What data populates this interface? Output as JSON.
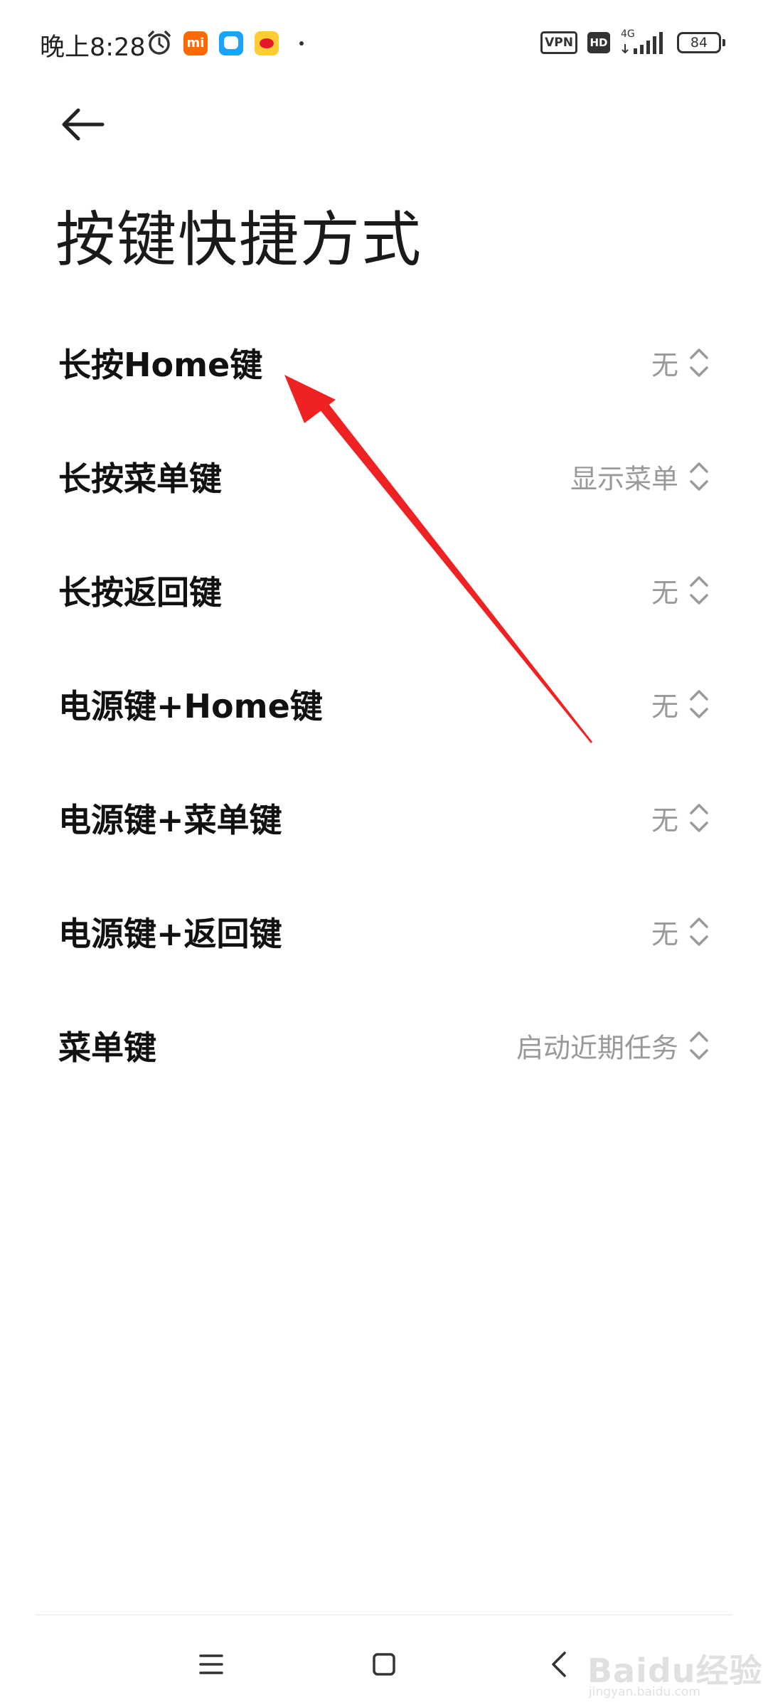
{
  "status_bar": {
    "time": "晚上8:28",
    "app_badges": [
      "mi",
      "message",
      "weibo"
    ],
    "mi_label": "mi",
    "vpn_label": "VPN",
    "hd_label": "HD",
    "network_label": "4G",
    "battery_level": "84",
    "icons": [
      "alarm-icon",
      "vpn-icon",
      "hd-icon",
      "signal-icon",
      "battery-icon"
    ]
  },
  "header": {
    "back_icon": "arrow-left-icon",
    "title": "按键快捷方式"
  },
  "settings": {
    "items": [
      {
        "label": "长按Home键",
        "value": "无"
      },
      {
        "label": "长按菜单键",
        "value": "显示菜单"
      },
      {
        "label": "长按返回键",
        "value": "无"
      },
      {
        "label": "电源键+Home键",
        "value": "无"
      },
      {
        "label": "电源键+菜单键",
        "value": "无"
      },
      {
        "label": "电源键+返回键",
        "value": "无"
      },
      {
        "label": "菜单键",
        "value": "启动近期任务"
      }
    ],
    "chevron_icon": "chevron-up-down-icon"
  },
  "annotation": {
    "color": "#ee2222"
  },
  "nav_bar": {
    "icons": [
      "menu-icon",
      "home-icon",
      "back-icon"
    ]
  },
  "watermark": {
    "text": "Baidu经验",
    "sub": "jingyan.baidu.com"
  }
}
